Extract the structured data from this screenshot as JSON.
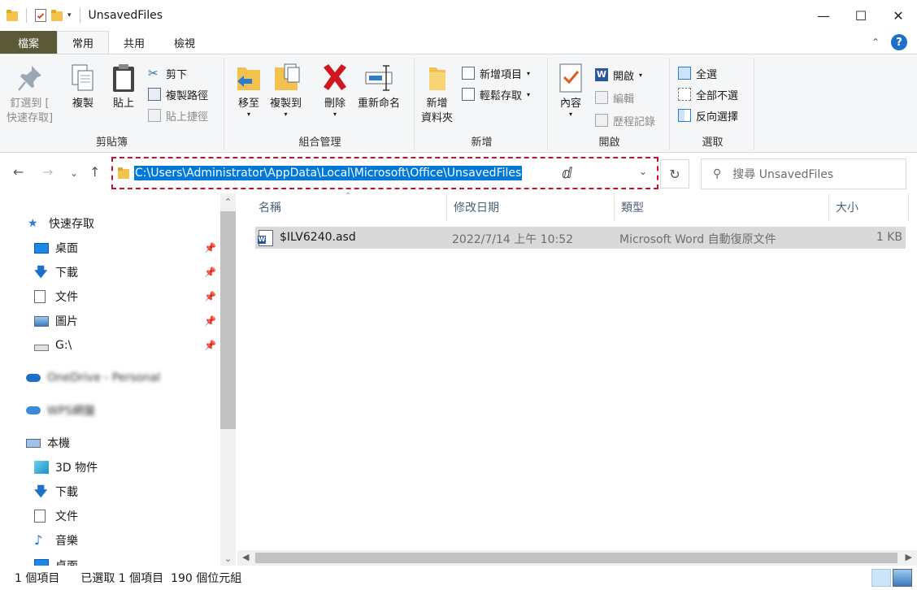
{
  "window": {
    "title": "UnsavedFiles",
    "controls": [
      "minimize",
      "maximize",
      "close"
    ]
  },
  "ribbon_tabs": [
    {
      "label": "檔案"
    },
    {
      "label": "常用",
      "active": true
    },
    {
      "label": "共用"
    },
    {
      "label": "檢視"
    }
  ],
  "ribbon": {
    "clipboard": {
      "label": "剪貼簿",
      "pin": "釘選到 [",
      "pin2": "快速存取]",
      "copy": "複製",
      "paste": "貼上",
      "cut": "剪下",
      "copy_path": "複製路徑",
      "paste_shortcut": "貼上捷徑"
    },
    "organize": {
      "label": "組合管理",
      "move": "移至",
      "copyto": "複製到",
      "delete": "刪除",
      "rename": "重新命名"
    },
    "new": {
      "label": "新增",
      "new_folder_1": "新增",
      "new_folder_2": "資料夾",
      "new_item": "新增項目",
      "easy_access": "輕鬆存取"
    },
    "open": {
      "label": "開啟",
      "properties": "內容",
      "open": "開啟",
      "edit": "編輯",
      "history": "歷程記錄"
    },
    "select": {
      "label": "選取",
      "select_all": "全選",
      "select_none": "全部不選",
      "invert": "反向選擇"
    }
  },
  "address": {
    "path": "C:\\Users\\Administrator\\AppData\\Local\\Microsoft\\Office\\UnsavedFiles"
  },
  "search": {
    "placeholder": "搜尋 UnsavedFiles"
  },
  "nav_pane": [
    {
      "label": "快速存取",
      "icon": "star-icon",
      "level": 0
    },
    {
      "label": "桌面",
      "icon": "desktop-icon",
      "level": 1,
      "pinned": true
    },
    {
      "label": "下載",
      "icon": "download-icon",
      "level": 1,
      "pinned": true
    },
    {
      "label": "文件",
      "icon": "documents-icon",
      "level": 1,
      "pinned": true
    },
    {
      "label": "圖片",
      "icon": "pictures-icon",
      "level": 1,
      "pinned": true
    },
    {
      "label": "G:\\",
      "icon": "drive-icon",
      "level": 1,
      "pinned": true
    },
    {
      "label": "OneDrive - Personal",
      "icon": "onedrive-icon",
      "level": 0,
      "blurred": true
    },
    {
      "label": "WPS網盤",
      "icon": "cloud-icon",
      "level": 0,
      "blurred": true
    },
    {
      "label": "本機",
      "icon": "computer-icon",
      "level": 0
    },
    {
      "label": "3D 物件",
      "icon": "3d-objects-icon",
      "level": 1
    },
    {
      "label": "下載",
      "icon": "download-icon",
      "level": 1
    },
    {
      "label": "文件",
      "icon": "documents-icon",
      "level": 1
    },
    {
      "label": "音樂",
      "icon": "music-icon",
      "level": 1
    },
    {
      "label": "桌面",
      "icon": "desktop-icon",
      "level": 1
    }
  ],
  "columns": [
    {
      "label": "名稱"
    },
    {
      "label": "修改日期"
    },
    {
      "label": "類型"
    },
    {
      "label": "大小"
    }
  ],
  "files": [
    {
      "name": "$ILV6240.asd",
      "date": "2022/7/14 上午 10:52",
      "type": "Microsoft Word 自動復原文件",
      "size": "1 KB"
    }
  ],
  "status": {
    "count": "1 個項目",
    "selected": "已選取 1 個項目  190 個位元組"
  },
  "colors": {
    "accent": "#0078d7",
    "file_tab": "#5a5a38",
    "highlight_border": "#c8102e",
    "selected_row": "#d9d9d9"
  }
}
